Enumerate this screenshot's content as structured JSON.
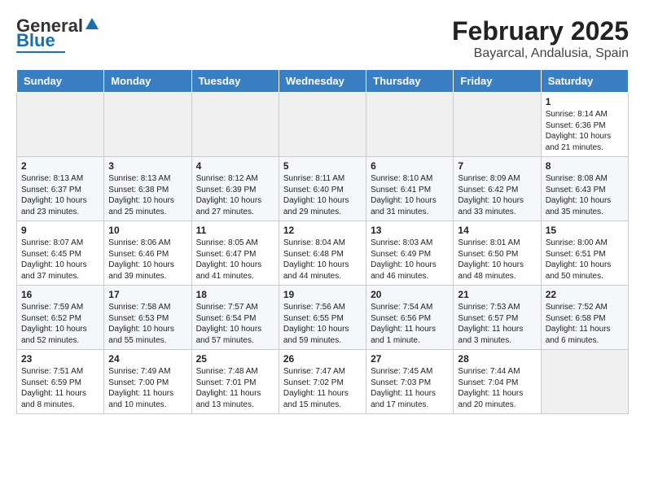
{
  "logo": {
    "general": "General",
    "blue": "Blue"
  },
  "title": "February 2025",
  "subtitle": "Bayarcal, Andalusia, Spain",
  "weekdays": [
    "Sunday",
    "Monday",
    "Tuesday",
    "Wednesday",
    "Thursday",
    "Friday",
    "Saturday"
  ],
  "weeks": [
    [
      {
        "day": "",
        "info": ""
      },
      {
        "day": "",
        "info": ""
      },
      {
        "day": "",
        "info": ""
      },
      {
        "day": "",
        "info": ""
      },
      {
        "day": "",
        "info": ""
      },
      {
        "day": "",
        "info": ""
      },
      {
        "day": "1",
        "info": "Sunrise: 8:14 AM\nSunset: 6:36 PM\nDaylight: 10 hours\nand 21 minutes."
      }
    ],
    [
      {
        "day": "2",
        "info": "Sunrise: 8:13 AM\nSunset: 6:37 PM\nDaylight: 10 hours\nand 23 minutes."
      },
      {
        "day": "3",
        "info": "Sunrise: 8:13 AM\nSunset: 6:38 PM\nDaylight: 10 hours\nand 25 minutes."
      },
      {
        "day": "4",
        "info": "Sunrise: 8:12 AM\nSunset: 6:39 PM\nDaylight: 10 hours\nand 27 minutes."
      },
      {
        "day": "5",
        "info": "Sunrise: 8:11 AM\nSunset: 6:40 PM\nDaylight: 10 hours\nand 29 minutes."
      },
      {
        "day": "6",
        "info": "Sunrise: 8:10 AM\nSunset: 6:41 PM\nDaylight: 10 hours\nand 31 minutes."
      },
      {
        "day": "7",
        "info": "Sunrise: 8:09 AM\nSunset: 6:42 PM\nDaylight: 10 hours\nand 33 minutes."
      },
      {
        "day": "8",
        "info": "Sunrise: 8:08 AM\nSunset: 6:43 PM\nDaylight: 10 hours\nand 35 minutes."
      }
    ],
    [
      {
        "day": "9",
        "info": "Sunrise: 8:07 AM\nSunset: 6:45 PM\nDaylight: 10 hours\nand 37 minutes."
      },
      {
        "day": "10",
        "info": "Sunrise: 8:06 AM\nSunset: 6:46 PM\nDaylight: 10 hours\nand 39 minutes."
      },
      {
        "day": "11",
        "info": "Sunrise: 8:05 AM\nSunset: 6:47 PM\nDaylight: 10 hours\nand 41 minutes."
      },
      {
        "day": "12",
        "info": "Sunrise: 8:04 AM\nSunset: 6:48 PM\nDaylight: 10 hours\nand 44 minutes."
      },
      {
        "day": "13",
        "info": "Sunrise: 8:03 AM\nSunset: 6:49 PM\nDaylight: 10 hours\nand 46 minutes."
      },
      {
        "day": "14",
        "info": "Sunrise: 8:01 AM\nSunset: 6:50 PM\nDaylight: 10 hours\nand 48 minutes."
      },
      {
        "day": "15",
        "info": "Sunrise: 8:00 AM\nSunset: 6:51 PM\nDaylight: 10 hours\nand 50 minutes."
      }
    ],
    [
      {
        "day": "16",
        "info": "Sunrise: 7:59 AM\nSunset: 6:52 PM\nDaylight: 10 hours\nand 52 minutes."
      },
      {
        "day": "17",
        "info": "Sunrise: 7:58 AM\nSunset: 6:53 PM\nDaylight: 10 hours\nand 55 minutes."
      },
      {
        "day": "18",
        "info": "Sunrise: 7:57 AM\nSunset: 6:54 PM\nDaylight: 10 hours\nand 57 minutes."
      },
      {
        "day": "19",
        "info": "Sunrise: 7:56 AM\nSunset: 6:55 PM\nDaylight: 10 hours\nand 59 minutes."
      },
      {
        "day": "20",
        "info": "Sunrise: 7:54 AM\nSunset: 6:56 PM\nDaylight: 11 hours\nand 1 minute."
      },
      {
        "day": "21",
        "info": "Sunrise: 7:53 AM\nSunset: 6:57 PM\nDaylight: 11 hours\nand 3 minutes."
      },
      {
        "day": "22",
        "info": "Sunrise: 7:52 AM\nSunset: 6:58 PM\nDaylight: 11 hours\nand 6 minutes."
      }
    ],
    [
      {
        "day": "23",
        "info": "Sunrise: 7:51 AM\nSunset: 6:59 PM\nDaylight: 11 hours\nand 8 minutes."
      },
      {
        "day": "24",
        "info": "Sunrise: 7:49 AM\nSunset: 7:00 PM\nDaylight: 11 hours\nand 10 minutes."
      },
      {
        "day": "25",
        "info": "Sunrise: 7:48 AM\nSunset: 7:01 PM\nDaylight: 11 hours\nand 13 minutes."
      },
      {
        "day": "26",
        "info": "Sunrise: 7:47 AM\nSunset: 7:02 PM\nDaylight: 11 hours\nand 15 minutes."
      },
      {
        "day": "27",
        "info": "Sunrise: 7:45 AM\nSunset: 7:03 PM\nDaylight: 11 hours\nand 17 minutes."
      },
      {
        "day": "28",
        "info": "Sunrise: 7:44 AM\nSunset: 7:04 PM\nDaylight: 11 hours\nand 20 minutes."
      },
      {
        "day": "",
        "info": ""
      }
    ]
  ]
}
